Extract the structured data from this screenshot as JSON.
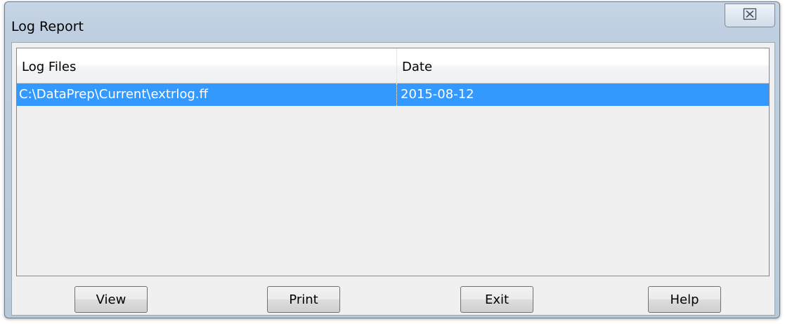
{
  "window": {
    "title": "Log Report",
    "close_symbol": "⊠"
  },
  "list": {
    "columns": [
      "Log Files",
      "Date"
    ],
    "rows": [
      {
        "file": "C:\\DataPrep\\Current\\extrlog.ff",
        "date": "2015-08-12",
        "selected": true
      }
    ]
  },
  "buttons": {
    "view": "View",
    "print": "Print",
    "exit": "Exit",
    "help": "Help"
  },
  "colors": {
    "selection": "#3399ff",
    "selection_text": "#ffffff",
    "frame": "#bfcfe1",
    "client_bg": "#f0f0f0"
  },
  "icons": {
    "close": "close-icon"
  }
}
